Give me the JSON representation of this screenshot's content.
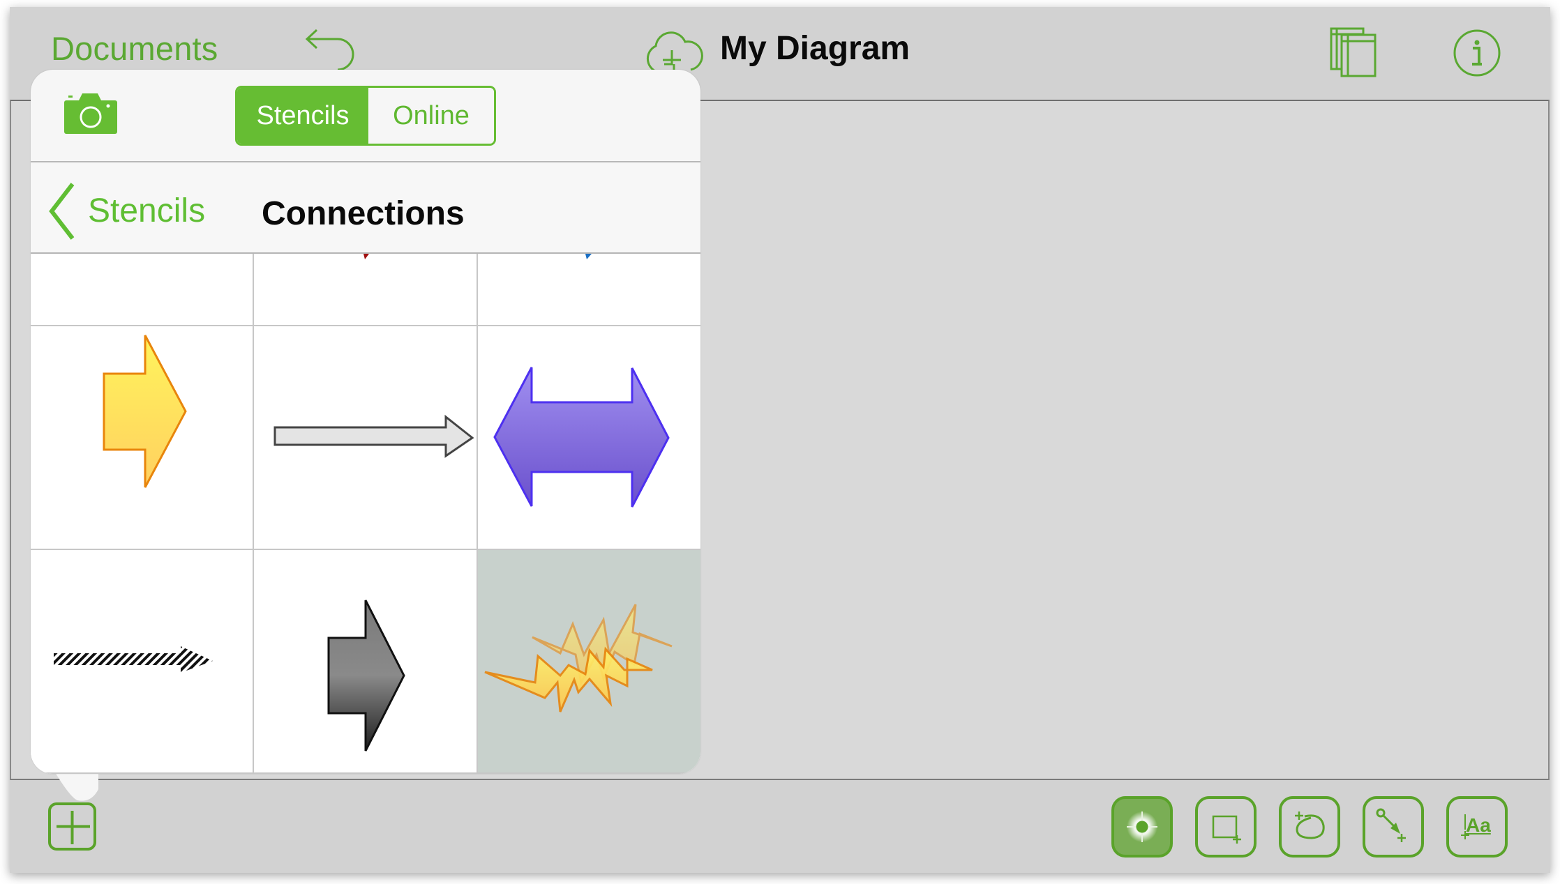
{
  "app": {
    "header": {
      "documents_label": "Documents",
      "title": "My Diagram",
      "icons": {
        "undo": "undo-arrow-icon",
        "cloud_sync": "cloud-sync-icon",
        "canvases": "canvases-icon",
        "info": "info-icon"
      }
    },
    "popover": {
      "camera_icon": "camera-icon",
      "segments": [
        {
          "label": "Stencils",
          "selected": true
        },
        {
          "label": "Online",
          "selected": false
        }
      ],
      "nav": {
        "back_label": "Stencils",
        "title": "Connections"
      },
      "stencils": [
        {
          "name": "partial-blank",
          "row": 0,
          "col": 0
        },
        {
          "name": "red-arrow-partial",
          "row": 0,
          "col": 1
        },
        {
          "name": "blue-arrow-partial",
          "row": 0,
          "col": 2
        },
        {
          "name": "yellow-block-arrow",
          "row": 1,
          "col": 0
        },
        {
          "name": "outline-thin-arrow",
          "row": 1,
          "col": 1
        },
        {
          "name": "purple-double-arrow",
          "row": 1,
          "col": 2
        },
        {
          "name": "hatched-arrow",
          "row": 2,
          "col": 0
        },
        {
          "name": "dark-gradient-arrow",
          "row": 2,
          "col": 1
        },
        {
          "name": "lightning-bolts",
          "row": 2,
          "col": 2,
          "selected": true
        }
      ]
    },
    "toolbar": {
      "add_icon": "plus-icon",
      "tools": [
        {
          "name": "selection-tool",
          "icon": "target-icon",
          "active": true
        },
        {
          "name": "shape-tool",
          "icon": "rectangle-plus-icon",
          "active": false
        },
        {
          "name": "freehand-tool",
          "icon": "lasso-plus-icon",
          "active": false
        },
        {
          "name": "line-tool",
          "icon": "connector-plus-icon",
          "active": false
        },
        {
          "name": "text-tool",
          "icon": "text-aa-icon",
          "label": "Aa",
          "active": false
        }
      ]
    },
    "colors": {
      "accent": "#66bd33",
      "accent_dark": "#5aa32a",
      "header_bg": "#d2d2d2",
      "canvas_bg": "#d9d9d9",
      "popover_bg": "#f6f6f6",
      "selected_cell": "#c8d1cc"
    }
  }
}
